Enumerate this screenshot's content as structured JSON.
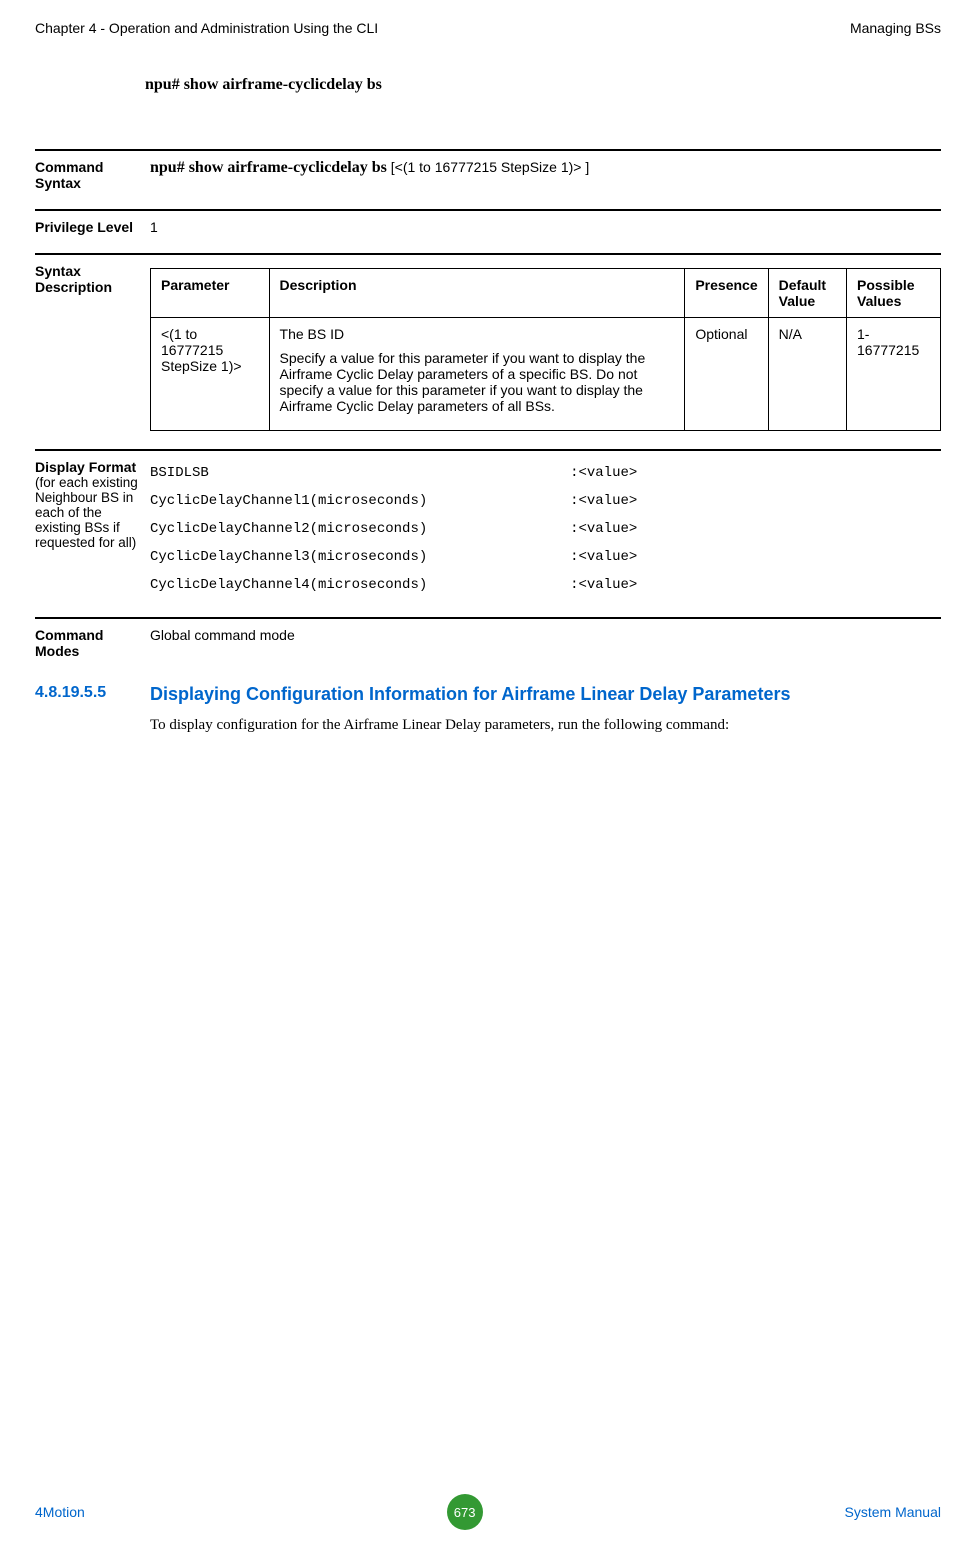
{
  "header": {
    "left": "Chapter 4 - Operation and Administration Using the CLI",
    "right": "Managing BSs"
  },
  "command_display": "npu# show airframe-cyclicdelay bs",
  "command_syntax": {
    "label": "Command Syntax",
    "bold": "npu# show airframe-cyclicdelay bs",
    "param": " [<(1 to 16777215 StepSize 1)> ]"
  },
  "privilege": {
    "label": "Privilege Level",
    "value": "1"
  },
  "syntax_description": {
    "label": "Syntax Description",
    "headers": [
      "Parameter",
      "Description",
      "Presence",
      "Default Value",
      "Possible Values"
    ],
    "row": {
      "parameter": "<(1 to 16777215 StepSize 1)>",
      "desc_line1": "The BS ID",
      "desc_line2": "Specify a value for this parameter if you want to display the Airframe Cyclic Delay parameters of a specific BS. Do not specify a value for this parameter if you want to display the Airframe Cyclic Delay parameters of all BSs.",
      "presence": "Optional",
      "default": "N/A",
      "possible": "1-16777215"
    }
  },
  "display_format": {
    "label": "Display Format",
    "sublabel": "(for each existing Neighbour BS in each of the existing BSs if requested for all)",
    "lines": "BSIDLSB                                           :<value>\nCyclicDelayChannel1(microseconds)                 :<value>\nCyclicDelayChannel2(microseconds)                 :<value>\nCyclicDelayChannel3(microseconds)                 :<value>\nCyclicDelayChannel4(microseconds)                 :<value>"
  },
  "command_modes": {
    "label": "Command Modes",
    "value": "Global command mode"
  },
  "subsection": {
    "number": "4.8.19.5.5",
    "title": "Displaying Configuration Information for Airframe Linear Delay Parameters",
    "body": "To display configuration for the Airframe Linear Delay parameters, run the following command:"
  },
  "footer": {
    "left": "4Motion",
    "center": "673",
    "right": "System Manual"
  }
}
